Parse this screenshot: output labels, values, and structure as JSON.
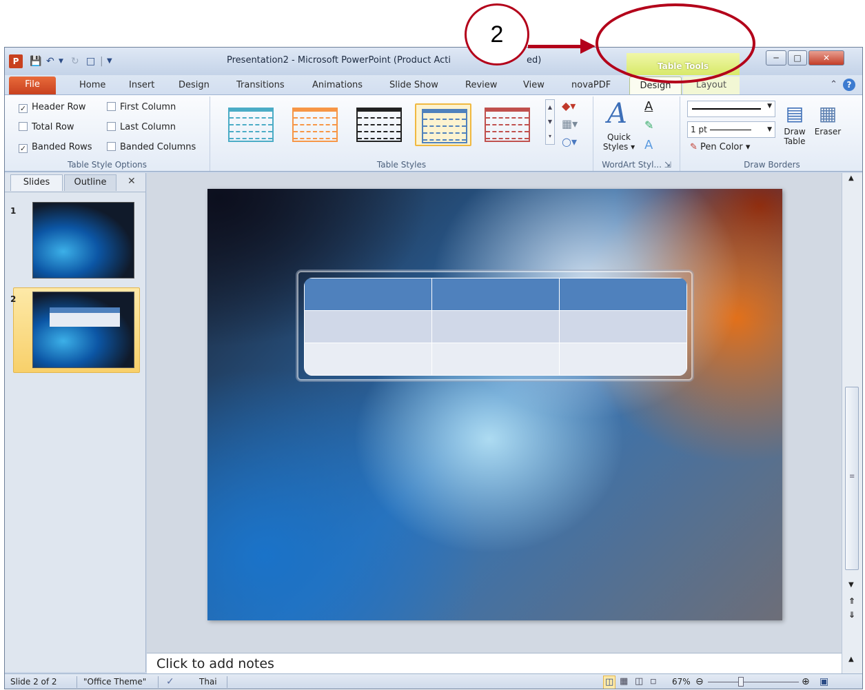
{
  "window": {
    "title": "Presentation2 - Microsoft PowerPoint (Product Acti",
    "title_end": "ed)",
    "app_icon": "P"
  },
  "contextual": {
    "header": "Table Tools"
  },
  "tabs": [
    "Home",
    "Insert",
    "Design",
    "Transitions",
    "Animations",
    "Slide Show",
    "Review",
    "View",
    "novaPDF"
  ],
  "file_tab": "File",
  "context_tabs": {
    "design": "Design",
    "layout": "Layout"
  },
  "table_style_options": {
    "label": "Table Style Options",
    "items": [
      {
        "label": "Header Row",
        "checked": true
      },
      {
        "label": "First Column",
        "checked": false
      },
      {
        "label": "Total Row",
        "checked": false
      },
      {
        "label": "Last Column",
        "checked": false
      },
      {
        "label": "Banded Rows",
        "checked": true
      },
      {
        "label": "Banded Columns",
        "checked": false
      }
    ]
  },
  "table_styles": {
    "label": "Table Styles",
    "colors": [
      "#4bacc6",
      "#f79646",
      "#222222",
      "#4f81bd",
      "#c0504d"
    ],
    "selected_index": 3
  },
  "wordart": {
    "label": "WordArt Styl...",
    "quick_styles": "Quick",
    "quick_styles2": "Styles"
  },
  "draw_borders": {
    "label": "Draw Borders",
    "pen_weight": "1 pt",
    "pen_color": "Pen Color",
    "draw_table": "Draw",
    "draw_table2": "Table",
    "eraser": "Eraser"
  },
  "pane": {
    "slides_tab": "Slides",
    "outline_tab": "Outline",
    "slide_numbers": [
      "1",
      "2"
    ]
  },
  "notes": {
    "placeholder": "Click to add notes"
  },
  "status": {
    "slide": "Slide 2 of 2",
    "theme": "\"Office Theme\"",
    "language": "Thai",
    "zoom": "67%"
  },
  "annotation": {
    "number": "2",
    "color": "#b3001a"
  },
  "table": {
    "header_color": "#4f81bd",
    "band1": "#d0d8e8",
    "band2": "#e9edf4"
  }
}
